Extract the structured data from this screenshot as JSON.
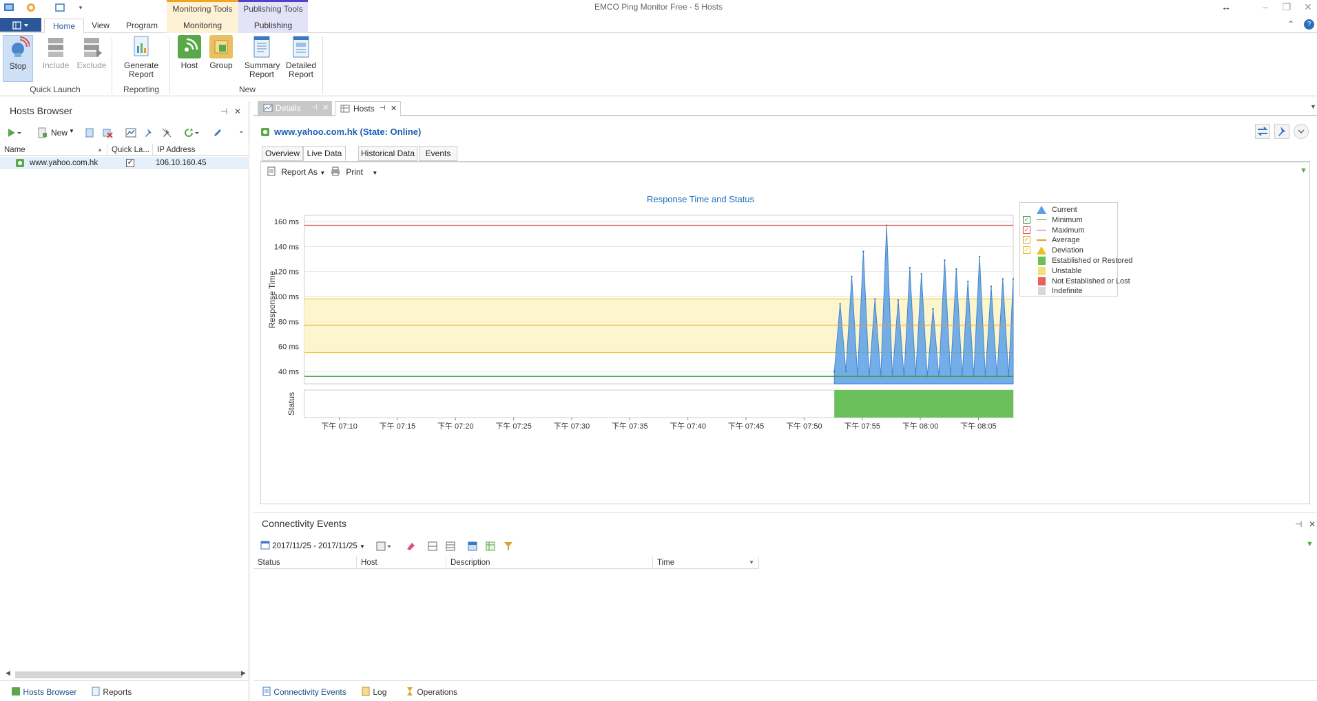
{
  "window": {
    "title": "EMCO Ping Monitor Free - 5 Hosts",
    "context_tabs": [
      "Monitoring Tools",
      "Publishing Tools"
    ]
  },
  "ribbon": {
    "tabs": [
      "Home",
      "View",
      "Program",
      "Monitoring",
      "Publishing"
    ],
    "active_tab": "Home",
    "buttons": {
      "stop": "Stop",
      "include": "Include",
      "exclude": "Exclude",
      "generate_report": "Generate Report",
      "host": "Host",
      "group": "Group",
      "summary_report": "Summary Report",
      "detailed_report": "Detailed Report"
    },
    "groups": {
      "quick_launch": "Quick Launch",
      "reporting": "Reporting",
      "new": "New"
    }
  },
  "hosts_browser": {
    "title": "Hosts Browser",
    "new_label": "New",
    "columns": [
      "Name",
      "Quick La...",
      "IP Address"
    ],
    "rows": [
      {
        "name": "www.yahoo.com.hk",
        "quick_launch": true,
        "ip": "106.10.160.45"
      }
    ],
    "bottom_tabs": [
      "Hosts Browser",
      "Reports"
    ]
  },
  "documents": {
    "tabs": [
      "Details",
      "Hosts"
    ],
    "active_tab": "Details"
  },
  "details": {
    "host_title": "www.yahoo.com.hk (State: Online)",
    "subtabs": [
      "Overview",
      "Live Data",
      "Historical Data",
      "Events"
    ],
    "active_subtab": "Live Data",
    "toolbar": {
      "report_as": "Report As",
      "print": "Print"
    }
  },
  "chart_data": {
    "type": "area",
    "title": "Response Time and Status",
    "ylabel": "Response Time",
    "status_label": "Status",
    "ylim": [
      30,
      165
    ],
    "yticks": [
      40,
      60,
      80,
      100,
      120,
      140,
      160
    ],
    "ytick_labels": [
      "40 ms",
      "60 ms",
      "80 ms",
      "100 ms",
      "120 ms",
      "140 ms",
      "160 ms"
    ],
    "xlim": [
      "07:07",
      "08:08"
    ],
    "xticks": [
      "07:10",
      "07:15",
      "07:20",
      "07:25",
      "07:30",
      "07:35",
      "07:40",
      "07:45",
      "07:50",
      "07:55",
      "08:00",
      "08:05"
    ],
    "xtick_labels": [
      "下午 07:10",
      "下午 07:15",
      "下午 07:20",
      "下午 07:25",
      "下午 07:30",
      "下午 07:35",
      "下午 07:40",
      "下午 07:45",
      "下午 07:50",
      "下午 07:55",
      "下午 08:00",
      "下午 08:05"
    ],
    "minimum": 36,
    "maximum": 157,
    "average": 77,
    "deviation_band": [
      55,
      98
    ],
    "current": {
      "x": [
        "07:52.6",
        "07:53.1",
        "07:53.6",
        "07:54.1",
        "07:54.6",
        "07:55.1",
        "07:55.6",
        "07:56.1",
        "07:56.6",
        "07:57.1",
        "07:57.6",
        "07:58.1",
        "07:58.6",
        "07:59.1",
        "07:59.6",
        "08:00.1",
        "08:00.6",
        "08:01.1",
        "08:01.6",
        "08:02.1",
        "08:02.6",
        "08:03.1",
        "08:03.6",
        "08:04.1",
        "08:04.6",
        "08:05.1",
        "08:05.6",
        "08:06.1",
        "08:06.6",
        "08:07.1",
        "08:07.6",
        "08:08.0"
      ],
      "values": [
        40,
        94,
        40,
        116,
        36,
        136,
        36,
        98,
        36,
        157,
        36,
        97,
        36,
        123,
        36,
        118,
        36,
        90,
        36,
        129,
        36,
        122,
        36,
        112,
        36,
        132,
        36,
        108,
        36,
        114,
        36,
        114
      ]
    },
    "status_established_from": "07:52.6",
    "legend": [
      {
        "label": "Current",
        "color": "#5aa0e8",
        "checkbox": false
      },
      {
        "label": "Minimum",
        "color": "#3a9a3a",
        "checkbox": true
      },
      {
        "label": "Maximum",
        "color": "#e05050",
        "checkbox": true
      },
      {
        "label": "Average",
        "color": "#e8a020",
        "checkbox": true
      },
      {
        "label": "Deviation",
        "color": "#e8c020",
        "checkbox": true
      },
      {
        "label": "Established or Restored",
        "color": "#6cc05c",
        "checkbox": false
      },
      {
        "label": "Unstable",
        "color": "#f2e07a",
        "checkbox": false
      },
      {
        "label": "Not Established or Lost",
        "color": "#e86060",
        "checkbox": false
      },
      {
        "label": "Indefinite",
        "color": "#d8d8d8",
        "checkbox": false
      }
    ]
  },
  "connectivity_events": {
    "title": "Connectivity Events",
    "date_range": "2017/11/25 - 2017/11/25",
    "columns": [
      "Status",
      "Host",
      "Description",
      "Time"
    ],
    "bottom_tabs": [
      "Connectivity Events",
      "Log",
      "Operations"
    ]
  }
}
